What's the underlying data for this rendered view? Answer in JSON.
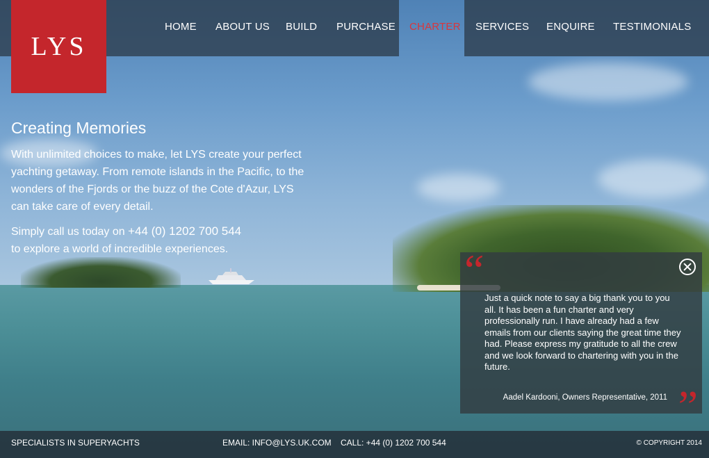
{
  "logo": {
    "text": "LYS"
  },
  "nav": {
    "items": [
      {
        "label": "HOME"
      },
      {
        "label": "ABOUT US"
      },
      {
        "label": "BUILD"
      },
      {
        "label": "PURCHASE"
      },
      {
        "label": "CHARTER"
      },
      {
        "label": "SERVICES"
      },
      {
        "label": "ENQUIRE"
      },
      {
        "label": "TESTIMONIALS"
      }
    ],
    "active": "CHARTER"
  },
  "intro": {
    "title": "Creating Memories",
    "paragraph": "With unlimited choices to make, let LYS create your perfect yachting getaway. From remote islands in the Pacific, to the wonders of the Fjords or the buzz of the Cote d'Azur, LYS can take care of every detail.",
    "call_prefix": "Simply call us today on ",
    "phone": "+44 (0) 1202 700 544",
    "call_suffix": "to explore a world of incredible experiences."
  },
  "testimonial": {
    "open_quote": "“",
    "close_quote": "”",
    "text": "Just a quick note to say a big thank you to you all. It has been a fun charter and very professionally run. I have already had a few emails from our clients saying the great time they had. Please express my gratitude to all the crew and we look forward to chartering with you in the future.",
    "author": "Aadel Kardooni, Owners Representative, 2011"
  },
  "footer": {
    "tagline": "SPECIALISTS IN SUPERYACHTS",
    "email": "EMAIL: INFO@LYS.UK.COM",
    "call": "CALL: +44 (0) 1202 700 544",
    "copyright": "© COPYRIGHT 2014"
  },
  "colors": {
    "brand_red": "#c4262c",
    "nav_active": "#d9363c",
    "overlay_dark": "#2d3c4b"
  }
}
